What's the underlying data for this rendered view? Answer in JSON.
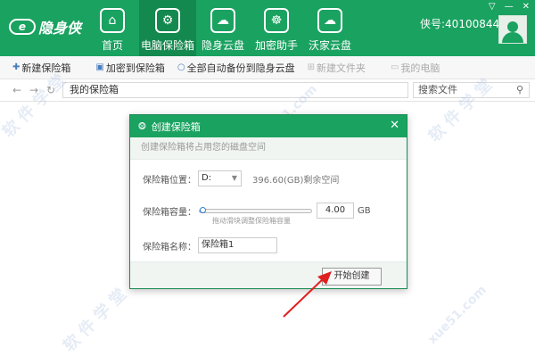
{
  "app": {
    "logo_mark": "e",
    "logo_text": "隐身侠",
    "user_id": "侠号:40100844",
    "window_controls": [
      "▽",
      "—",
      "✕"
    ]
  },
  "nav": {
    "items": [
      {
        "label": "首页",
        "icon": "home-icon",
        "glyph": "⌂"
      },
      {
        "label": "电脑保险箱",
        "icon": "safe-icon",
        "glyph": "⚙",
        "active": true
      },
      {
        "label": "隐身云盘",
        "icon": "cloud-icon",
        "glyph": "☁"
      },
      {
        "label": "加密助手",
        "icon": "encrypt-gear-icon",
        "glyph": "☸"
      },
      {
        "label": "沃家云盘",
        "icon": "family-cloud-icon",
        "glyph": "☁"
      }
    ]
  },
  "toolbar": {
    "new_safe": "新建保险箱",
    "encrypt_to_safe": "加密到保险箱",
    "backup_all": "全部自动备份到隐身云盘",
    "new_file": "新建文件夹",
    "my_computer": "我的电脑"
  },
  "address": {
    "path": "我的保险箱",
    "search_placeholder": "搜索文件"
  },
  "dialog": {
    "title": "创建保险箱",
    "subtitle": "创建保险箱将占用您的磁盘空间",
    "location_label": "保险箱位置：",
    "drive": "D:",
    "free_space": "396.60(GB)剩余空间",
    "capacity_label": "保险箱容量：",
    "capacity_value": "4.00",
    "capacity_unit": "GB",
    "capacity_fraction": 0.02,
    "slider_hint": "拖动滑块调整保险箱容量",
    "name_label": "保险箱名称：",
    "name_value": "保险箱1",
    "start_button": "开始创建"
  },
  "watermarks": [
    "软 件 学 堂",
    "软 件 学 堂",
    "软 件 学 堂",
    "xue51.com",
    "xue51.com"
  ]
}
